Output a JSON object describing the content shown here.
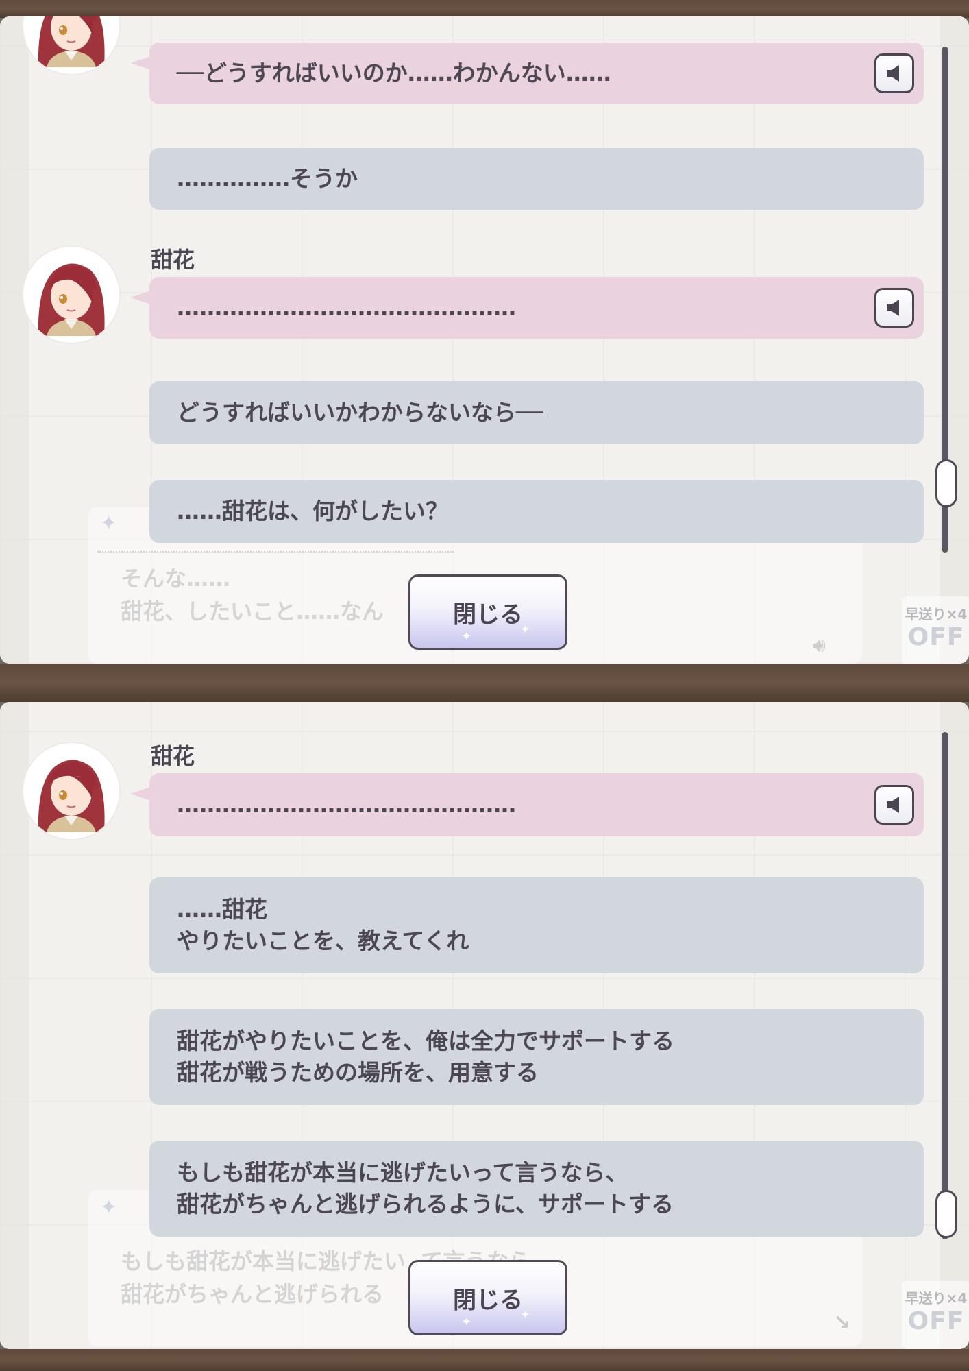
{
  "top_panel": {
    "background_text": {
      "line1": "そんな……",
      "line2": "甜花、したいこと……なん"
    },
    "skip": {
      "label": "早送り×4",
      "state": "OFF"
    },
    "messages": [
      {
        "id": "m1",
        "text": "──どうすればいいのか……わかんない……"
      },
      {
        "id": "m2",
        "text": "……………そうか"
      },
      {
        "id": "m3",
        "speaker": "甜花",
        "text": "………………………………………"
      },
      {
        "id": "m4",
        "text": "どうすればいいかわからないなら──"
      },
      {
        "id": "m5",
        "text": "……甜花は、何がしたい？"
      }
    ],
    "close_label": "閉じる"
  },
  "bottom_panel": {
    "background_text": {
      "line1": "もしも甜花が本当に逃げたい  て言うなら",
      "line2": "甜花がちゃんと逃げられる          ートする"
    },
    "skip": {
      "label": "早送り×4",
      "state": "OFF"
    },
    "messages": [
      {
        "id": "b1",
        "speaker": "甜花",
        "text": "………………………………………"
      },
      {
        "id": "b2",
        "text": "……甜花\nやりたいことを、教えてくれ"
      },
      {
        "id": "b3",
        "text": "甜花がやりたいことを、俺は全力でサポートする\n甜花が戦うための場所を、用意する"
      },
      {
        "id": "b4",
        "text": "もしも甜花が本当に逃げたいって言うなら、\n甜花がちゃんと逃げられるように、サポートする"
      }
    ],
    "close_label": "閉じる"
  },
  "colors": {
    "idol_bubble": "#ead3de",
    "producer_bubble": "#d2d6dd",
    "text": "#4c4752",
    "scrollbar": "#5c5662"
  },
  "icons": {
    "voice": "speaker-icon",
    "avatar": "tenka-avatar"
  }
}
